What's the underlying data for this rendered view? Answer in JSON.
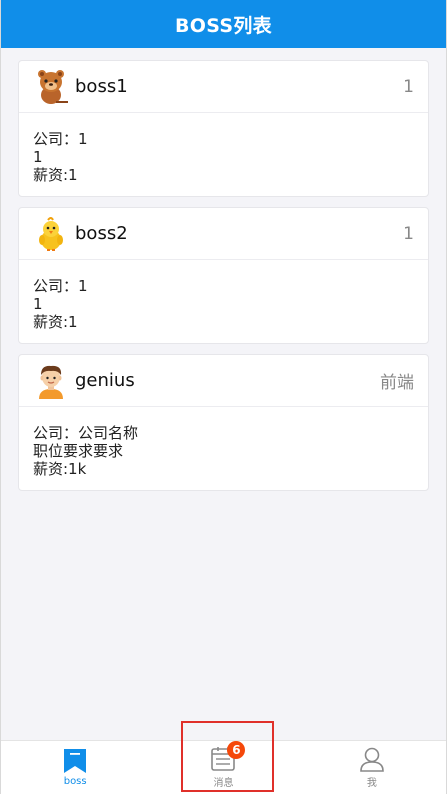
{
  "navbar": {
    "title": "BOSS列表"
  },
  "cards": [
    {
      "name": "boss1",
      "extra": "1",
      "avatar": "bear-avatar-icon",
      "lines": [
        "公司：1",
        "1",
        "薪资:1"
      ]
    },
    {
      "name": "boss2",
      "extra": "1",
      "avatar": "chick-avatar-icon",
      "lines": [
        "公司：1",
        "1",
        "薪资:1"
      ]
    },
    {
      "name": "genius",
      "extra": "前端",
      "avatar": "boy-avatar-icon",
      "lines": [
        "公司：公司名称",
        "职位要求要求",
        "薪资:1k"
      ]
    }
  ],
  "tabbar": {
    "items": [
      {
        "label": "boss",
        "icon": "bookmark-icon",
        "active": true
      },
      {
        "label": "消息",
        "icon": "message-list-icon",
        "badge": "6"
      },
      {
        "label": "我",
        "icon": "user-icon"
      }
    ]
  },
  "colors": {
    "primary": "#108ee9",
    "badge": "#f5480a",
    "highlight": "#e0302a"
  }
}
